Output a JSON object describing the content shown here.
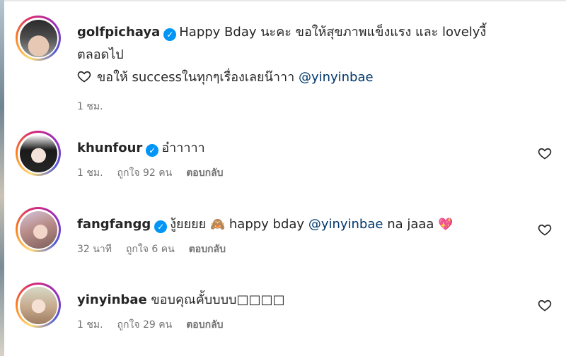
{
  "comments": [
    {
      "username": "golfpichaya",
      "verified": true,
      "text_line1": "Happy Bday นะคะ ขอให้สุขภาพแข็งแรง และ lovelyงี้",
      "text_line2": "ตลอดไป",
      "text_line3": "ขอให้ successในทุกๆเรื่องเลยน๊าาา",
      "mention": "@yinyinbae",
      "time": "1 ชม."
    },
    {
      "username": "khunfour",
      "verified": true,
      "text": "อ๋าาาาา",
      "time": "1 ชม.",
      "likes": "ถูกใจ 92 คน",
      "reply": "ตอบกลับ"
    },
    {
      "username": "fangfangg",
      "verified": true,
      "text_prefix": "งู้ยยยย",
      "emoji1": "🙈",
      "text_mid": "happy bday",
      "mention": "@yinyinbae",
      "text_suffix": "na jaaa",
      "emoji2": "💖",
      "time": "32 นาที",
      "likes": "ถูกใจ 6 คน",
      "reply": "ตอบกลับ"
    },
    {
      "username": "yinyinbae",
      "verified": false,
      "text": "ขอบคุณคั้บบบบ□□□□",
      "time": "1 ชม.",
      "likes": "ถูกใจ 29 คน",
      "reply": "ตอบกลับ"
    }
  ],
  "icons": {
    "verified_mark": "✓",
    "like": "heart-outline-icon"
  },
  "colors": {
    "verified": "#0095f6",
    "mention": "#00376b",
    "meta": "#737373"
  }
}
